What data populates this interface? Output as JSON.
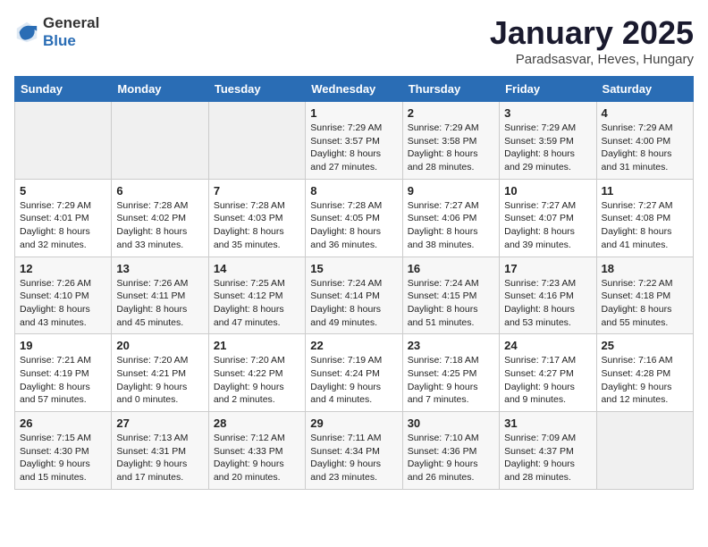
{
  "header": {
    "logo_general": "General",
    "logo_blue": "Blue",
    "month_title": "January 2025",
    "subtitle": "Paradsasvar, Heves, Hungary"
  },
  "days_of_week": [
    "Sunday",
    "Monday",
    "Tuesday",
    "Wednesday",
    "Thursday",
    "Friday",
    "Saturday"
  ],
  "weeks": [
    [
      {
        "day": "",
        "info": ""
      },
      {
        "day": "",
        "info": ""
      },
      {
        "day": "",
        "info": ""
      },
      {
        "day": "1",
        "info": "Sunrise: 7:29 AM\nSunset: 3:57 PM\nDaylight: 8 hours and 27 minutes."
      },
      {
        "day": "2",
        "info": "Sunrise: 7:29 AM\nSunset: 3:58 PM\nDaylight: 8 hours and 28 minutes."
      },
      {
        "day": "3",
        "info": "Sunrise: 7:29 AM\nSunset: 3:59 PM\nDaylight: 8 hours and 29 minutes."
      },
      {
        "day": "4",
        "info": "Sunrise: 7:29 AM\nSunset: 4:00 PM\nDaylight: 8 hours and 31 minutes."
      }
    ],
    [
      {
        "day": "5",
        "info": "Sunrise: 7:29 AM\nSunset: 4:01 PM\nDaylight: 8 hours and 32 minutes."
      },
      {
        "day": "6",
        "info": "Sunrise: 7:28 AM\nSunset: 4:02 PM\nDaylight: 8 hours and 33 minutes."
      },
      {
        "day": "7",
        "info": "Sunrise: 7:28 AM\nSunset: 4:03 PM\nDaylight: 8 hours and 35 minutes."
      },
      {
        "day": "8",
        "info": "Sunrise: 7:28 AM\nSunset: 4:05 PM\nDaylight: 8 hours and 36 minutes."
      },
      {
        "day": "9",
        "info": "Sunrise: 7:27 AM\nSunset: 4:06 PM\nDaylight: 8 hours and 38 minutes."
      },
      {
        "day": "10",
        "info": "Sunrise: 7:27 AM\nSunset: 4:07 PM\nDaylight: 8 hours and 39 minutes."
      },
      {
        "day": "11",
        "info": "Sunrise: 7:27 AM\nSunset: 4:08 PM\nDaylight: 8 hours and 41 minutes."
      }
    ],
    [
      {
        "day": "12",
        "info": "Sunrise: 7:26 AM\nSunset: 4:10 PM\nDaylight: 8 hours and 43 minutes."
      },
      {
        "day": "13",
        "info": "Sunrise: 7:26 AM\nSunset: 4:11 PM\nDaylight: 8 hours and 45 minutes."
      },
      {
        "day": "14",
        "info": "Sunrise: 7:25 AM\nSunset: 4:12 PM\nDaylight: 8 hours and 47 minutes."
      },
      {
        "day": "15",
        "info": "Sunrise: 7:24 AM\nSunset: 4:14 PM\nDaylight: 8 hours and 49 minutes."
      },
      {
        "day": "16",
        "info": "Sunrise: 7:24 AM\nSunset: 4:15 PM\nDaylight: 8 hours and 51 minutes."
      },
      {
        "day": "17",
        "info": "Sunrise: 7:23 AM\nSunset: 4:16 PM\nDaylight: 8 hours and 53 minutes."
      },
      {
        "day": "18",
        "info": "Sunrise: 7:22 AM\nSunset: 4:18 PM\nDaylight: 8 hours and 55 minutes."
      }
    ],
    [
      {
        "day": "19",
        "info": "Sunrise: 7:21 AM\nSunset: 4:19 PM\nDaylight: 8 hours and 57 minutes."
      },
      {
        "day": "20",
        "info": "Sunrise: 7:20 AM\nSunset: 4:21 PM\nDaylight: 9 hours and 0 minutes."
      },
      {
        "day": "21",
        "info": "Sunrise: 7:20 AM\nSunset: 4:22 PM\nDaylight: 9 hours and 2 minutes."
      },
      {
        "day": "22",
        "info": "Sunrise: 7:19 AM\nSunset: 4:24 PM\nDaylight: 9 hours and 4 minutes."
      },
      {
        "day": "23",
        "info": "Sunrise: 7:18 AM\nSunset: 4:25 PM\nDaylight: 9 hours and 7 minutes."
      },
      {
        "day": "24",
        "info": "Sunrise: 7:17 AM\nSunset: 4:27 PM\nDaylight: 9 hours and 9 minutes."
      },
      {
        "day": "25",
        "info": "Sunrise: 7:16 AM\nSunset: 4:28 PM\nDaylight: 9 hours and 12 minutes."
      }
    ],
    [
      {
        "day": "26",
        "info": "Sunrise: 7:15 AM\nSunset: 4:30 PM\nDaylight: 9 hours and 15 minutes."
      },
      {
        "day": "27",
        "info": "Sunrise: 7:13 AM\nSunset: 4:31 PM\nDaylight: 9 hours and 17 minutes."
      },
      {
        "day": "28",
        "info": "Sunrise: 7:12 AM\nSunset: 4:33 PM\nDaylight: 9 hours and 20 minutes."
      },
      {
        "day": "29",
        "info": "Sunrise: 7:11 AM\nSunset: 4:34 PM\nDaylight: 9 hours and 23 minutes."
      },
      {
        "day": "30",
        "info": "Sunrise: 7:10 AM\nSunset: 4:36 PM\nDaylight: 9 hours and 26 minutes."
      },
      {
        "day": "31",
        "info": "Sunrise: 7:09 AM\nSunset: 4:37 PM\nDaylight: 9 hours and 28 minutes."
      },
      {
        "day": "",
        "info": ""
      }
    ]
  ]
}
